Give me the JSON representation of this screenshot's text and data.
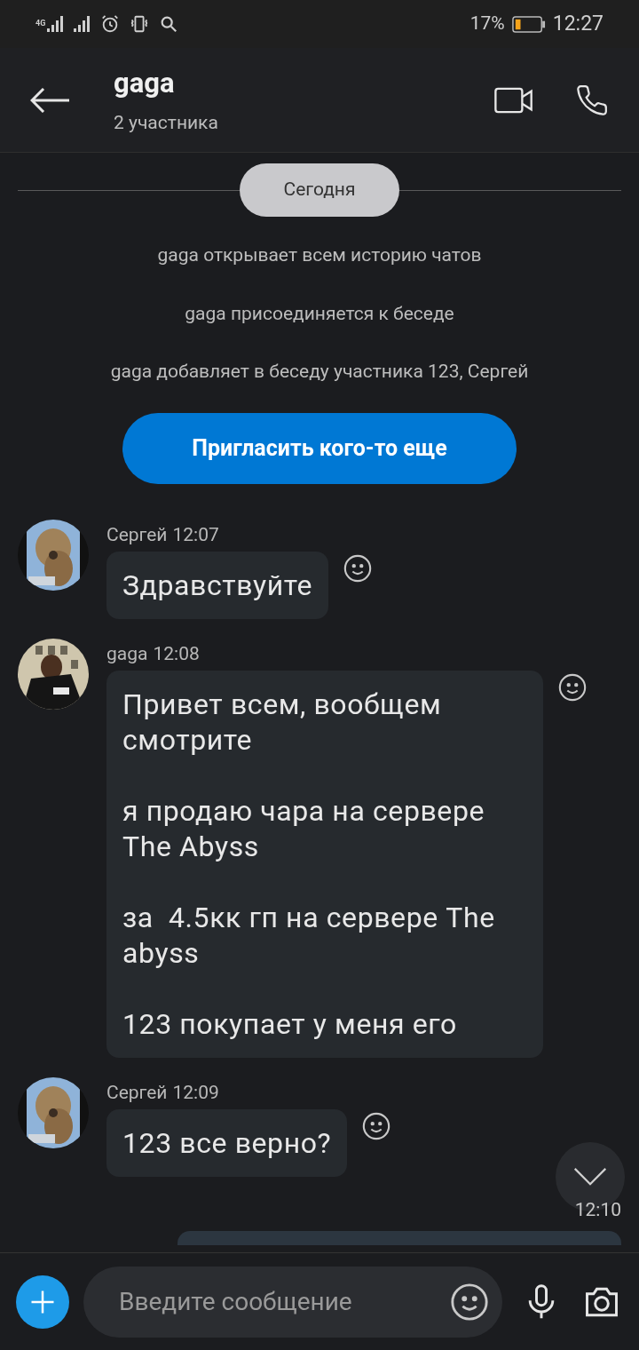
{
  "status_bar": {
    "network": "4G",
    "battery": "17%",
    "time": "12:27"
  },
  "header": {
    "title": "gaga",
    "subtitle": "2 участника"
  },
  "date_chip": "Сегодня",
  "system_messages": [
    "gaga открывает всем историю чатов",
    "gaga присоединяется к беседе",
    "gaga добавляет в беседу участника 123, Сергей"
  ],
  "invite_button": "Пригласить кого-то еще",
  "messages": [
    {
      "kind": "incoming",
      "sender": "Сергей",
      "time": "12:07",
      "text": "Здравствуйте"
    },
    {
      "kind": "incoming",
      "sender": "gaga",
      "time": "12:08",
      "text": "Привет всем, вообщем смотрите\n\nя продаю чара на сервере The Abyss\n\nза  4.5кк гп на сервере The abyss\n\n123 покупает у меня его"
    },
    {
      "kind": "incoming",
      "sender": "Сергей",
      "time": "12:09",
      "text": "123 все верно?"
    },
    {
      "kind": "outgoing",
      "time": "12:10"
    }
  ],
  "composer": {
    "placeholder": "Введите сообщение"
  }
}
